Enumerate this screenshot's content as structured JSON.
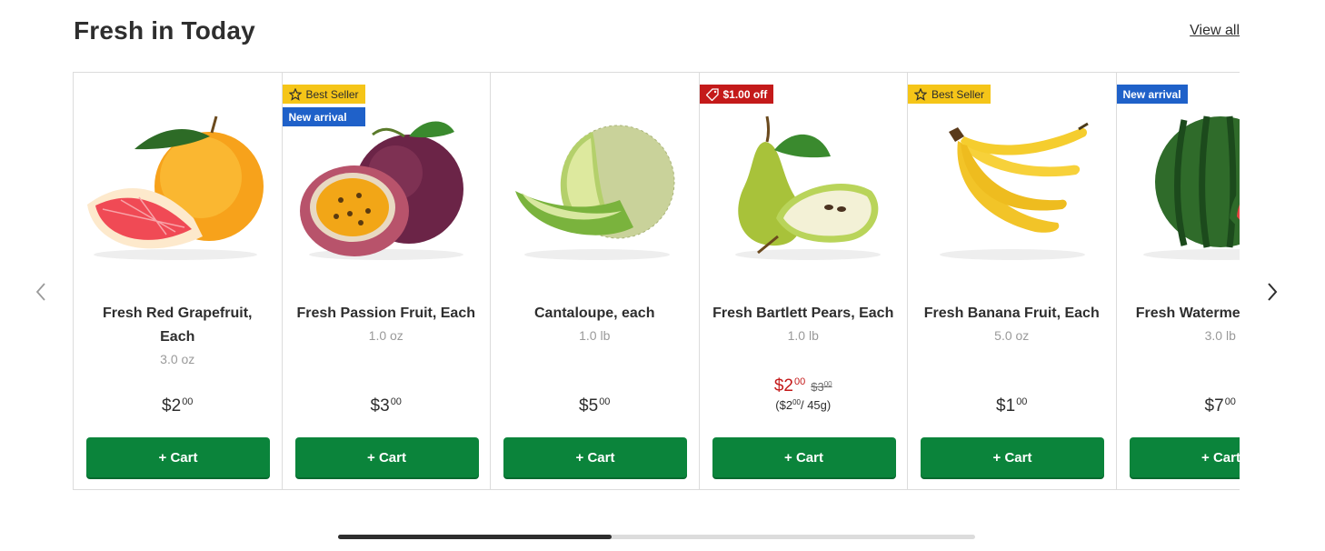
{
  "section": {
    "title": "Fresh in Today",
    "view_all_label": "View all",
    "prev_icon": "chevron-left-icon",
    "next_icon": "chevron-right-icon",
    "scroll_position": 0.43
  },
  "colors": {
    "accent_green": "#0b843b",
    "best_seller_yellow": "#f5c518",
    "new_arrival_blue": "#1f61c9",
    "deal_red": "#c41a1a"
  },
  "products": [
    {
      "name": "Fresh Red Grapefruit, Each",
      "size": "3.0 oz",
      "price_dollars": "$2",
      "price_cents": "00",
      "cart_label": "+ Cart",
      "image": "grapefruit-image"
    },
    {
      "badge_best": "Best Seller",
      "badge_new": "New arrival",
      "name": "Fresh Passion Fruit, Each",
      "size": "1.0 oz",
      "price_dollars": "$3",
      "price_cents": "00",
      "cart_label": "+ Cart",
      "image": "passion-fruit-image"
    },
    {
      "name": "Cantaloupe, each",
      "size": "1.0 lb",
      "price_dollars": "$5",
      "price_cents": "00",
      "cart_label": "+ Cart",
      "image": "cantaloupe-image"
    },
    {
      "badge_deal": "$1.00 off",
      "name": "Fresh Bartlett Pears, Each",
      "size": "1.0 lb",
      "price_dollars": "$2",
      "price_cents": "00",
      "old_price_dollars": "$3",
      "old_price_cents": "00",
      "unit_open": "($2",
      "unit_cents": "00",
      "unit_rest": "/ 45g)",
      "cart_label": "+ Cart",
      "image": "pear-image"
    },
    {
      "badge_best": "Best Seller",
      "name": "Fresh Banana Fruit, Each",
      "size": "5.0 oz",
      "price_dollars": "$1",
      "price_cents": "00",
      "cart_label": "+ Cart",
      "image": "banana-image"
    },
    {
      "badge_new": "New arrival",
      "name": "Fresh Watermelon, Each",
      "size": "3.0 lb",
      "price_dollars": "$7",
      "price_cents": "00",
      "cart_label": "+ Cart",
      "image": "watermelon-image"
    }
  ]
}
